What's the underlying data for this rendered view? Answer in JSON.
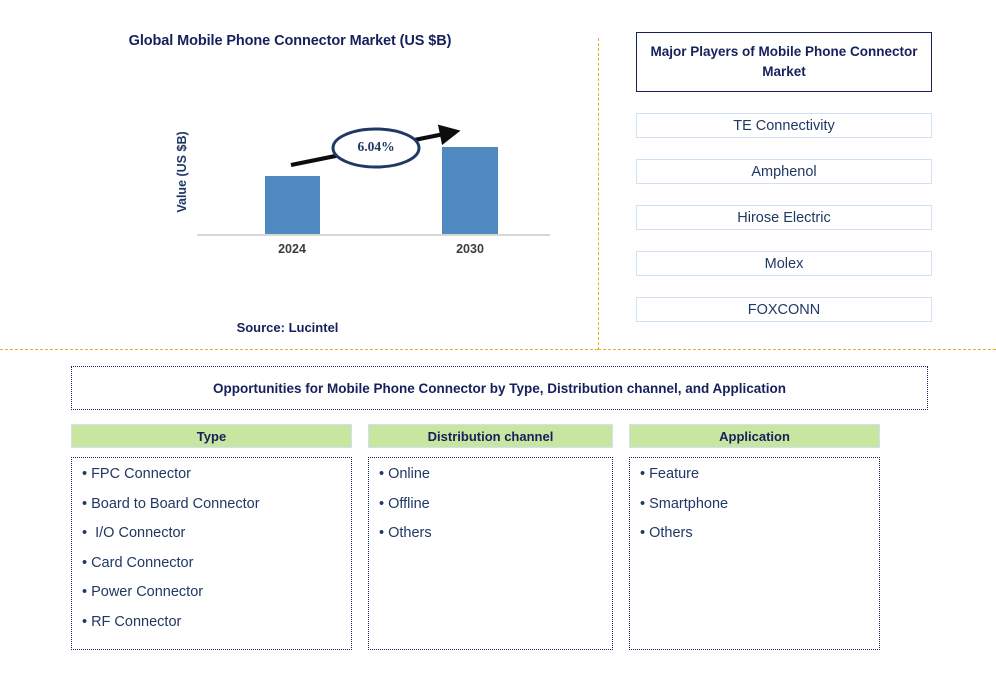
{
  "chart": {
    "title": "Global Mobile Phone Connector Market (US $B)",
    "ylabel": "Value (US $B)",
    "cagr_label": "6.04%",
    "tick_2024": "2024",
    "tick_2030": "2030",
    "source": "Source: Lucintel",
    "bar_color": "#5088c0",
    "text_color": "#16205c"
  },
  "chart_data": {
    "type": "bar",
    "title": "Global Mobile Phone Connector Market (US $B)",
    "xlabel": "",
    "ylabel": "Value (US $B)",
    "categories": [
      "2024",
      "2030"
    ],
    "values": [
      58,
      87
    ],
    "ylim": [
      0,
      110
    ],
    "grid": false,
    "legend": "none",
    "annotations": [
      {
        "text": "6.04%",
        "type": "cagr-callout",
        "from": "2024",
        "to": "2030"
      }
    ],
    "source": "Source: Lucintel"
  },
  "players": {
    "header": "Major Players of Mobile Phone Connector Market",
    "items": [
      "TE Connectivity",
      "Amphenol",
      "Hirose Electric",
      "Molex",
      "FOXCONN"
    ]
  },
  "opportunities": {
    "header": "Opportunities for Mobile Phone Connector by Type, Distribution channel, and Application",
    "header_bg": "#c8e6a0",
    "columns": [
      {
        "title": "Type",
        "items": [
          "FPC Connector",
          "Board to Board Connector",
          " I/O Connector",
          "Card Connector",
          "Power Connector",
          "RF Connector"
        ]
      },
      {
        "title": "Distribution channel",
        "items": [
          "Online",
          "Offline",
          "Others"
        ]
      },
      {
        "title": "Application",
        "items": [
          "Feature",
          "Smartphone",
          "Others"
        ]
      }
    ]
  }
}
